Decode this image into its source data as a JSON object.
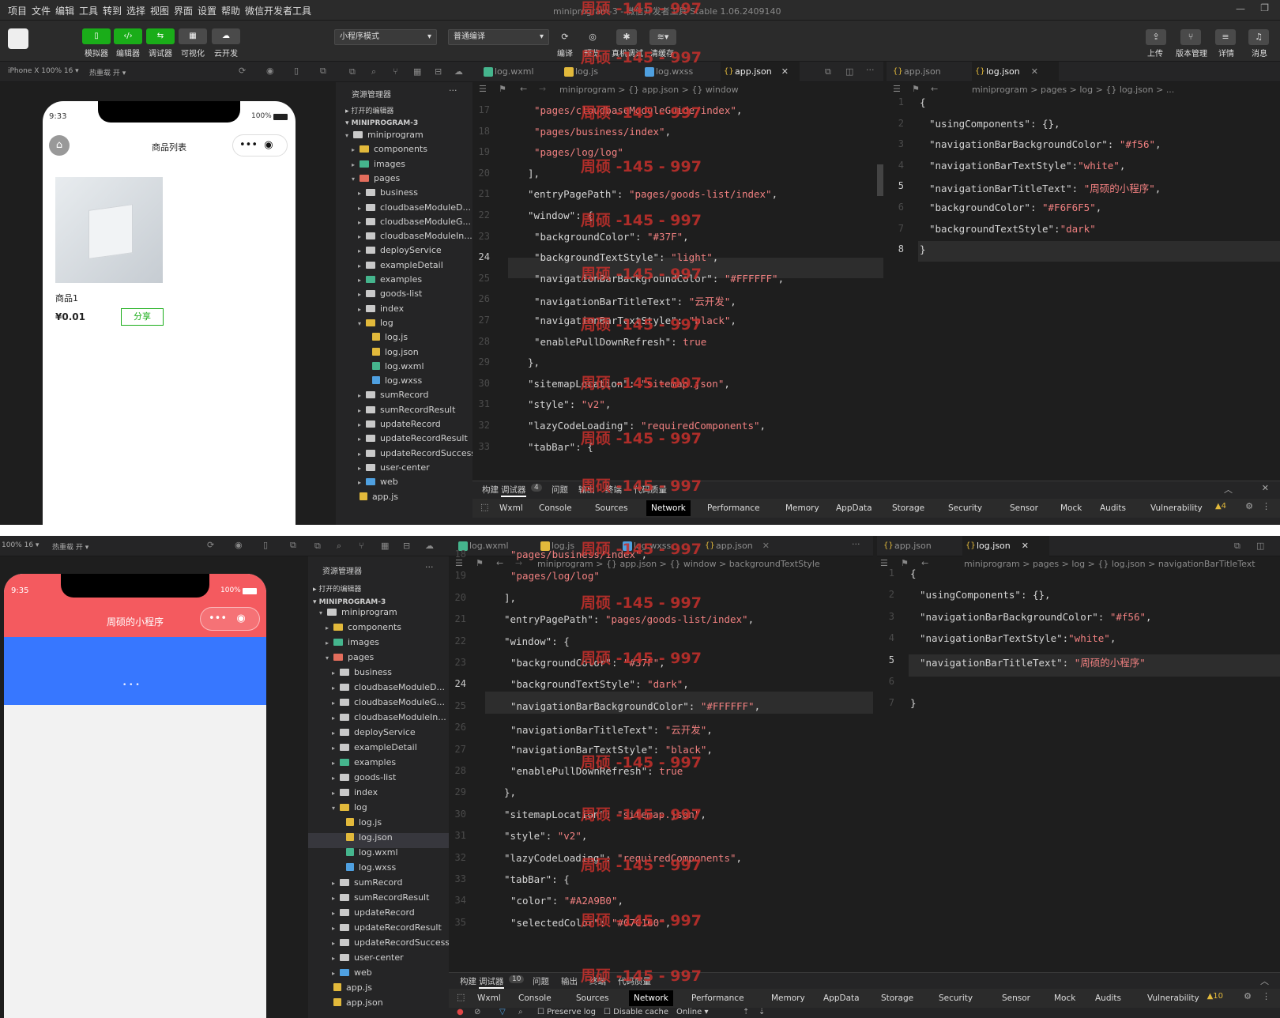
{
  "menu": [
    "项目",
    "文件",
    "编辑",
    "工具",
    "转到",
    "选择",
    "视图",
    "界面",
    "设置",
    "帮助",
    "微信开发者工具"
  ],
  "window_title": "miniprogram-3 - 微信开发者工具 Stable 1.06.2409140",
  "watermark": "周硕 -145 - 997",
  "toolbar": {
    "simulator": "模拟器",
    "editor": "编辑器",
    "debugger": "调试器",
    "visual": "可视化",
    "cloud": "云开发",
    "mode": "小程序模式",
    "compile_mode": "普通编译",
    "compile": "编译",
    "preview": "预览",
    "device_debug": "真机调试",
    "clear_cache": "清缓存",
    "upload": "上传",
    "version": "版本管理",
    "details": "详情",
    "messages": "消息"
  },
  "top": {
    "device": "iPhone X 100% 16 ▾",
    "hotreload": "热重载 开 ▾",
    "phone": {
      "time": "9:33",
      "battery": "100%",
      "nav_title": "商品列表",
      "product_name": "商品1",
      "price": "¥0.01",
      "share": "分享"
    },
    "explorer_title": "资源管理器",
    "open_editors": "打开的编辑器",
    "project": "MINIPROGRAM-3",
    "tree": [
      "miniprogram",
      "components",
      "images",
      "pages",
      "business",
      "cloudbaseModuleD...",
      "cloudbaseModuleG...",
      "cloudbaseModuleIn...",
      "deployService",
      "exampleDetail",
      "examples",
      "goods-list",
      "index",
      "log",
      "log.js",
      "log.json",
      "log.wxml",
      "log.wxss",
      "sumRecord",
      "sumRecordResult",
      "updateRecord",
      "updateRecordResult",
      "updateRecordSuccess",
      "user-center",
      "web",
      "app.js"
    ],
    "tabs": [
      "log.wxml",
      "log.js",
      "log.wxss",
      "app.json"
    ],
    "tabs_right": [
      "app.json",
      "log.json"
    ],
    "crumb_left": "miniprogram > {} app.json > {} window",
    "crumb_right": "miniprogram > pages > log > {} log.json > ...",
    "line_numbers": [
      "17",
      "18",
      "19",
      "20",
      "21",
      "22",
      "23",
      "24",
      "25",
      "26",
      "27",
      "28",
      "29",
      "30",
      "31",
      "32",
      "33"
    ],
    "code": [
      "\"pages/cloudbaseModuleGuide/index\",",
      "\"pages/business/index\",",
      "\"pages/log/log\"",
      "],",
      "\"entryPagePath\": \"pages/goods-list/index\",",
      "\"window\": {",
      "\"backgroundColor\": \"#37F\",",
      "\"backgroundTextStyle\": \"light\",",
      "\"navigationBarBackgroundColor\": \"#FFFFFF\",",
      "\"navigationBarTitleText\": \"云开发\",",
      "\"navigationBarTextStyle\": \"black\",",
      "\"enablePullDownRefresh\": true",
      "},",
      "\"sitemapLocation\": \"sitemap.json\",",
      "\"style\": \"v2\",",
      "\"lazyCodeLoading\": \"requiredComponents\",",
      "\"tabBar\": {"
    ],
    "right_line_numbers": [
      "1",
      "2",
      "3",
      "4",
      "5",
      "6",
      "7",
      "8"
    ],
    "right_code": [
      "{",
      "\"usingComponents\": {},",
      "\"navigationBarBackgroundColor\": \"#f56\",",
      "\"navigationBarTextStyle\":\"white\",",
      "\"navigationBarTitleText\": \"周硕的小程序\",",
      "\"backgroundColor\": \"#F6F6F5\",",
      "\"backgroundTextStyle\":\"dark\"",
      "}"
    ],
    "panel_tabs": [
      "构建",
      "调试器",
      "4",
      "问题",
      "输出",
      "终端",
      "代码质量"
    ],
    "devtools_tabs": [
      "Wxml",
      "Console",
      "Sources",
      "Network",
      "Performance",
      "Memory",
      "AppData",
      "Storage",
      "Security",
      "Sensor",
      "Mock",
      "Audits",
      "Vulnerability"
    ],
    "warning": "▲4"
  },
  "bottom": {
    "device": "100% 16 ▾",
    "hotreload": "热重载 开 ▾",
    "phone": {
      "time": "9:35",
      "battery": "100%",
      "nav_title": "周硕的小程序",
      "dots": "• • •"
    },
    "explorer_title": "资源管理器",
    "open_editors": "打开的编辑器",
    "project": "MINIPROGRAM-3",
    "tree": [
      "miniprogram",
      "components",
      "images",
      "pages",
      "business",
      "cloudbaseModuleD...",
      "cloudbaseModuleG...",
      "cloudbaseModuleIn...",
      "deployService",
      "exampleDetail",
      "examples",
      "goods-list",
      "index",
      "log",
      "log.js",
      "log.json",
      "log.wxml",
      "log.wxss",
      "sumRecord",
      "sumRecordResult",
      "updateRecord",
      "updateRecordResult",
      "updateRecordSuccess",
      "user-center",
      "web",
      "app.js",
      "app.json"
    ],
    "tabs": [
      "log.wxml",
      "log.js",
      "log.wxss",
      "app.json"
    ],
    "tabs_right": [
      "app.json",
      "log.json"
    ],
    "crumb_left": "miniprogram > {} app.json > {} window > backgroundTextStyle",
    "crumb_right": "miniprogram > pages > log > {} log.json > navigationBarTitleText",
    "line_numbers": [
      "18",
      "19",
      "20",
      "21",
      "22",
      "23",
      "24",
      "25",
      "26",
      "27",
      "28",
      "29",
      "30",
      "31",
      "32",
      "33",
      "34",
      "35"
    ],
    "code": [
      "\"pages/business/index\",",
      "\"pages/log/log\"",
      "],",
      "\"entryPagePath\": \"pages/goods-list/index\",",
      "\"window\": {",
      "\"backgroundColor\": \"#37F\",",
      "\"backgroundTextStyle\": \"dark\",",
      "\"navigationBarBackgroundColor\": \"#FFFFFF\",",
      "\"navigationBarTitleText\": \"云开发\",",
      "\"navigationBarTextStyle\": \"black\",",
      "\"enablePullDownRefresh\": true",
      "},",
      "\"sitemapLocation\": \"sitemap.json\",",
      "\"style\": \"v2\",",
      "\"lazyCodeLoading\": \"requiredComponents\",",
      "\"tabBar\": {",
      "\"color\": \"#A2A9B0\",",
      "\"selectedColor\": \"#07C160\","
    ],
    "right_line_numbers": [
      "1",
      "2",
      "3",
      "4",
      "5",
      "6",
      "7"
    ],
    "right_code": [
      "{",
      "\"usingComponents\": {},",
      "\"navigationBarBackgroundColor\": \"#f56\",",
      "\"navigationBarTextStyle\":\"white\",",
      "\"navigationBarTitleText\": \"周硕的小程序\"",
      "",
      "}"
    ],
    "panel_tabs": [
      "构建",
      "调试器",
      "10",
      "问题",
      "输出",
      "终端",
      "代码质量"
    ],
    "devtools_tabs": [
      "Wxml",
      "Console",
      "Sources",
      "Network",
      "Performance",
      "Memory",
      "AppData",
      "Storage",
      "Security",
      "Sensor",
      "Mock",
      "Audits",
      "Vulnerability"
    ],
    "warning": "▲10",
    "network_bar": {
      "preserve": "Preserve log",
      "disable_cache": "Disable cache",
      "online": "Online"
    }
  },
  "colors": {
    "accent_green": "#1aad19",
    "nav_red": "#f45a5f",
    "bg_blue": "#3777ff",
    "json_string": "#f08080"
  }
}
